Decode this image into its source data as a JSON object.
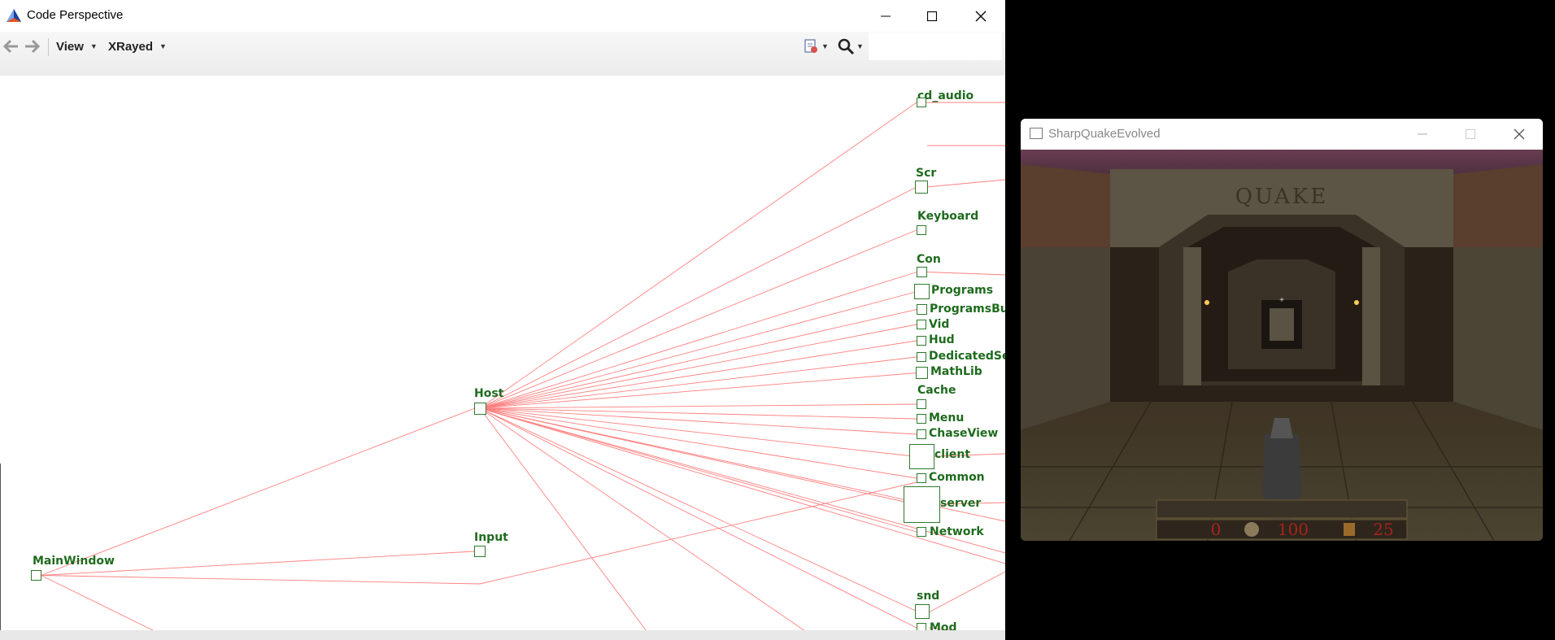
{
  "code_perspective": {
    "title": "Code Perspective",
    "toolbar": {
      "view_label": "View",
      "xrayed_label": "XRayed"
    },
    "graph": {
      "nodes": [
        {
          "id": "cd_audio",
          "label": "cd_audio"
        },
        {
          "id": "Scr",
          "label": "Scr"
        },
        {
          "id": "Keyboard",
          "label": "Keyboard"
        },
        {
          "id": "Con",
          "label": "Con"
        },
        {
          "id": "Programs",
          "label": "Programs"
        },
        {
          "id": "ProgramsBuil",
          "label": "ProgramsBuil"
        },
        {
          "id": "Vid",
          "label": "Vid"
        },
        {
          "id": "Hud",
          "label": "Hud"
        },
        {
          "id": "DedicatedSer",
          "label": "DedicatedSer"
        },
        {
          "id": "MathLib",
          "label": "MathLib"
        },
        {
          "id": "Cache",
          "label": "Cache"
        },
        {
          "id": "Menu",
          "label": "Menu"
        },
        {
          "id": "ChaseView",
          "label": "ChaseView"
        },
        {
          "id": "client",
          "label": "client"
        },
        {
          "id": "Common",
          "label": "Common"
        },
        {
          "id": "server",
          "label": "server"
        },
        {
          "id": "Network",
          "label": "Network"
        },
        {
          "id": "snd",
          "label": "snd"
        },
        {
          "id": "Mod",
          "label": "Mod"
        },
        {
          "id": "Host",
          "label": "Host"
        },
        {
          "id": "Input",
          "label": "Input"
        },
        {
          "id": "MainWindow",
          "label": "MainWindow"
        }
      ]
    }
  },
  "game_window": {
    "title": "SharpQuakeEvolved",
    "logo_text": "QUAKE",
    "hud": {
      "armor": "0",
      "health": "100",
      "ammo": "25"
    }
  },
  "colors": {
    "edge": "#ff8080",
    "node": "#2d7a2d",
    "label": "#1e6b1e"
  }
}
